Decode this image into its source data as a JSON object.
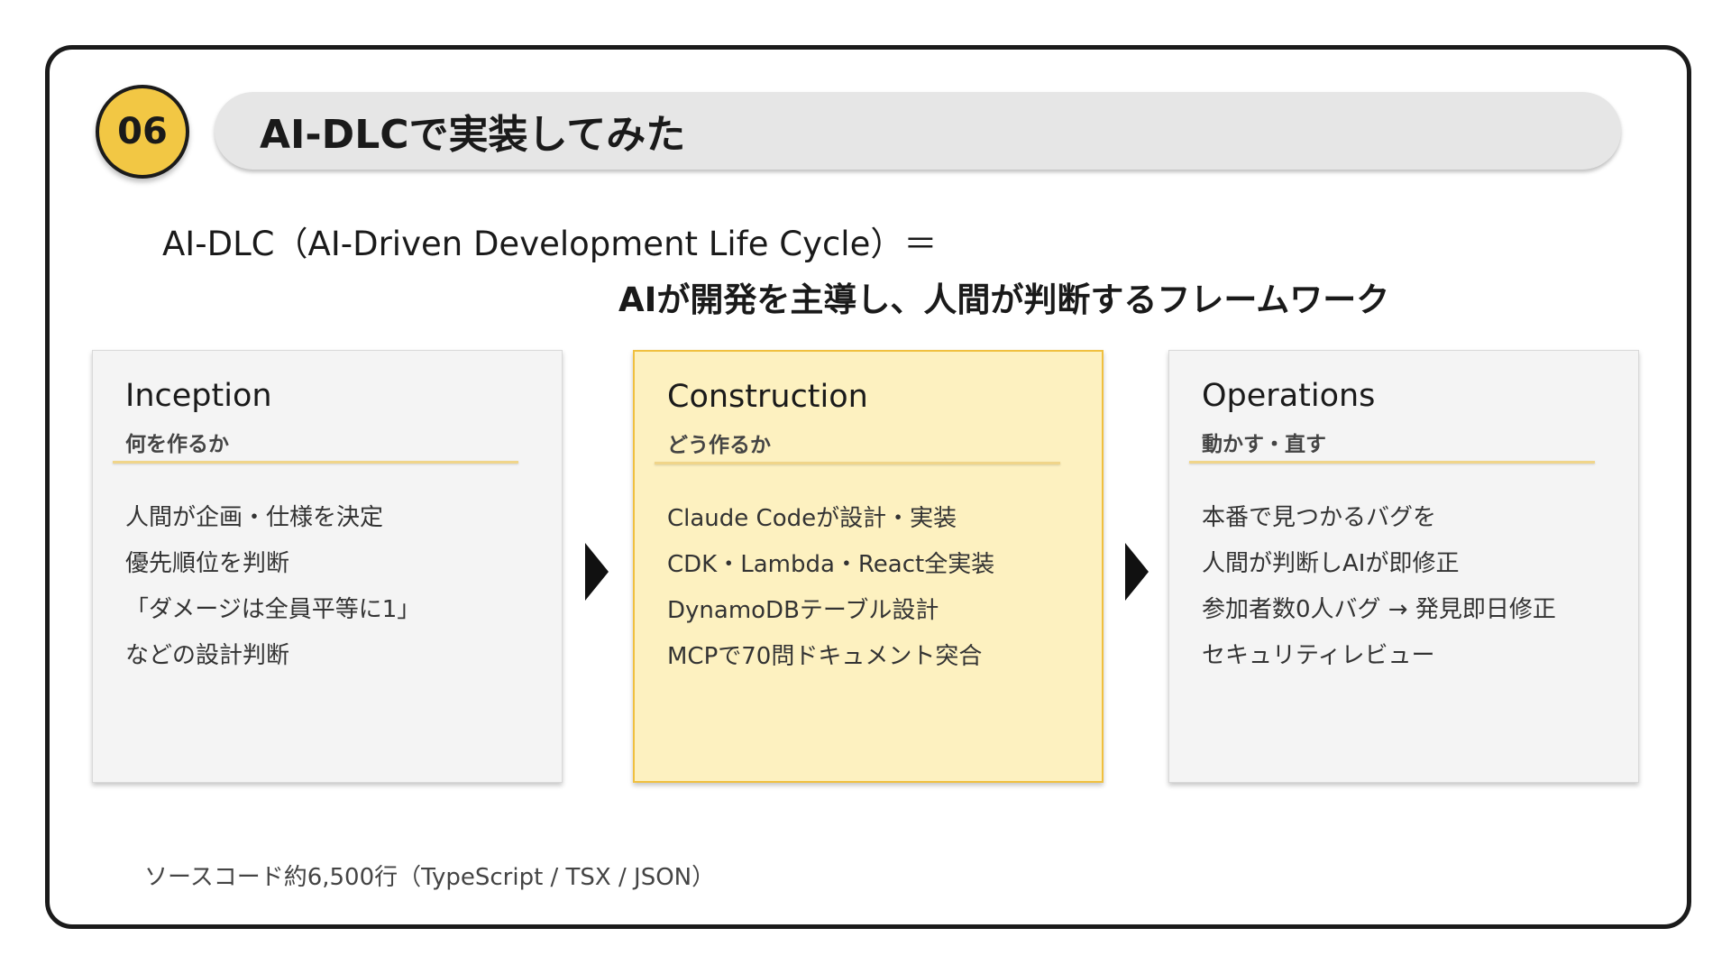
{
  "section": {
    "number": "06",
    "title": "AI-DLCで実装してみた"
  },
  "definition": {
    "line1": "AI-DLC（AI-Driven Development Life Cycle）＝",
    "line2": "AIが開発を主導し、人間が判断するフレームワーク"
  },
  "phases": [
    {
      "title": "Inception",
      "subtitle": "何を作るか",
      "items": [
        "人間が企画・仕様を決定",
        "優先順位を判断",
        "「ダメージは全員平等に1」",
        "などの設計判断"
      ]
    },
    {
      "title": "Construction",
      "subtitle": "どう作るか",
      "items": [
        "Claude Codeが設計・実装",
        "CDK・Lambda・React全実装",
        "DynamoDBテーブル設計",
        "MCPで70問ドキュメント突合"
      ]
    },
    {
      "title": "Operations",
      "subtitle": "動かす・直す",
      "items": [
        "本番で見つかるバグを",
        "人間が判断しAIが即修正",
        "参加者数0人バグ → 発見即日修正",
        "セキュリティレビュー"
      ]
    }
  ],
  "footer": {
    "note": "ソースコード約6,500行（TypeScript / TSX / JSON）"
  },
  "colors": {
    "accent": "#f2c744",
    "highlight_card": "#fdf1c0",
    "card_default": "#f4f4f4",
    "title_bar": "#e6e6e6"
  }
}
